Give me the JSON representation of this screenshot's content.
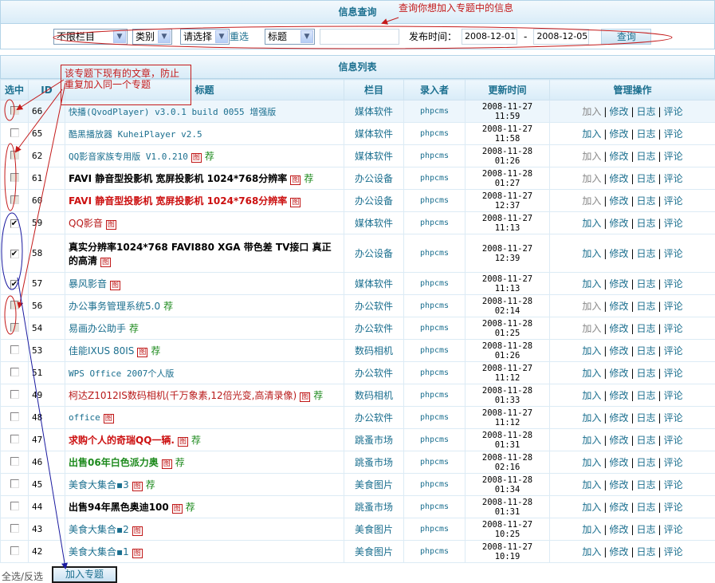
{
  "query_panel": {
    "title": "信息查询",
    "annotation": "查询你想加入专题中的信息",
    "column_select": "不限栏目",
    "type_select": "类别",
    "choose_select": "请选择",
    "reset_label": "重选",
    "field_select": "标题",
    "keyword_value": "",
    "date_label": "发布时间：",
    "date_from": "2008-12-01",
    "date_sep": "-",
    "date_to": "2008-12-05",
    "query_button": "查询"
  },
  "list_panel": {
    "title": "信息列表",
    "annotation": "该专题下现有的文章，防止重复加入同一个专题",
    "headers": [
      "选中",
      "ID",
      "标题",
      "栏目",
      "录入者",
      "更新时间",
      "管理操作"
    ],
    "ops": {
      "add": "加入",
      "edit": "修改",
      "log": "日志",
      "comment": "评论",
      "sep": "|"
    },
    "badge_img": "图",
    "badge_rec": "荐",
    "rows": [
      {
        "id": "66",
        "title": "快播(QvodPlayer) v3.0.1 build 0055 增强版",
        "style": "mono",
        "img": false,
        "rec": false,
        "category": "媒体软件",
        "user": "phpcms",
        "time": "2008-11-27 11:59",
        "check": "disabled",
        "add_disabled": true
      },
      {
        "id": "65",
        "title": "酷黑播放器 KuheiPlayer v2.5",
        "style": "mono",
        "img": false,
        "rec": false,
        "category": "媒体软件",
        "user": "phpcms",
        "time": "2008-11-27 11:58",
        "check": "unchecked",
        "add_disabled": false
      },
      {
        "id": "62",
        "title": "QQ影音家族专用版 V1.0.210",
        "style": "mono",
        "img": true,
        "rec": true,
        "category": "媒体软件",
        "user": "phpcms",
        "time": "2008-11-28 01:26",
        "check": "disabled",
        "add_disabled": true
      },
      {
        "id": "61",
        "title": "FAVI 静音型投影机 宽屏投影机 1024*768分辨率",
        "style": "bold",
        "img": true,
        "rec": true,
        "category": "办公设备",
        "user": "phpcms",
        "time": "2008-11-28 01:27",
        "check": "disabled",
        "add_disabled": true
      },
      {
        "id": "60",
        "title": "FAVI 静音型投影机 宽屏投影机 1024*768分辨率",
        "style": "red-bold",
        "img": true,
        "rec": false,
        "category": "办公设备",
        "user": "phpcms",
        "time": "2008-11-27 12:37",
        "check": "disabled",
        "add_disabled": true
      },
      {
        "id": "59",
        "title": "QQ影音",
        "style": "red",
        "img": true,
        "rec": false,
        "category": "媒体软件",
        "user": "phpcms",
        "time": "2008-11-27 11:13",
        "check": "checked",
        "add_disabled": false
      },
      {
        "id": "58",
        "title": "真实分辨率1024*768 FAVI880 XGA 带色差 TV接口 真正的高清",
        "style": "bold",
        "img": true,
        "rec": false,
        "category": "办公设备",
        "user": "phpcms",
        "time": "2008-11-27 12:39",
        "check": "checked",
        "add_disabled": false,
        "tall": true
      },
      {
        "id": "57",
        "title": "暴风影音",
        "style": "normal",
        "img": true,
        "rec": false,
        "category": "媒体软件",
        "user": "phpcms",
        "time": "2008-11-27 11:13",
        "check": "checked",
        "add_disabled": false
      },
      {
        "id": "56",
        "title": "办公事务管理系统5.0",
        "style": "normal",
        "img": false,
        "rec": true,
        "category": "办公软件",
        "user": "phpcms",
        "time": "2008-11-28 02:14",
        "check": "disabled",
        "add_disabled": true
      },
      {
        "id": "54",
        "title": "易画办公助手",
        "style": "normal",
        "img": false,
        "rec": true,
        "category": "办公软件",
        "user": "phpcms",
        "time": "2008-11-28 01:25",
        "check": "disabled",
        "add_disabled": true
      },
      {
        "id": "53",
        "title": "佳能IXUS 80IS",
        "style": "normal",
        "img": true,
        "rec": true,
        "category": "数码相机",
        "user": "phpcms",
        "time": "2008-11-28 01:26",
        "check": "unchecked",
        "add_disabled": false
      },
      {
        "id": "51",
        "title": "WPS Office 2007个人版",
        "style": "mono",
        "img": false,
        "rec": false,
        "category": "办公软件",
        "user": "phpcms",
        "time": "2008-11-27 11:12",
        "check": "unchecked",
        "add_disabled": false
      },
      {
        "id": "49",
        "title": "柯达Z1012IS数码相机(千万象素,12倍光变,高清录像)",
        "style": "red",
        "img": true,
        "rec": true,
        "category": "数码相机",
        "user": "phpcms",
        "time": "2008-11-28 01:33",
        "check": "unchecked",
        "add_disabled": false
      },
      {
        "id": "48",
        "title": "office",
        "style": "mono",
        "img": true,
        "rec": false,
        "category": "办公软件",
        "user": "phpcms",
        "time": "2008-11-27 11:12",
        "check": "unchecked",
        "add_disabled": false
      },
      {
        "id": "47",
        "title": "求购个人的奇瑞QQ一辆.",
        "style": "red-bold",
        "img": true,
        "rec": true,
        "category": "跳蚤市场",
        "user": "phpcms",
        "time": "2008-11-28 01:31",
        "check": "unchecked",
        "add_disabled": false
      },
      {
        "id": "46",
        "title": "出售06年白色派力奥",
        "style": "green-bold",
        "img": true,
        "rec": true,
        "category": "跳蚤市场",
        "user": "phpcms",
        "time": "2008-11-28 02:16",
        "check": "unchecked",
        "add_disabled": false
      },
      {
        "id": "45",
        "title": "美食大集合▪3",
        "style": "normal",
        "img": true,
        "rec": true,
        "category": "美食图片",
        "user": "phpcms",
        "time": "2008-11-28 01:34",
        "check": "unchecked",
        "add_disabled": false
      },
      {
        "id": "44",
        "title": "出售94年黑色奥迪100",
        "style": "bold",
        "img": true,
        "rec": true,
        "category": "跳蚤市场",
        "user": "phpcms",
        "time": "2008-11-28 01:31",
        "check": "unchecked",
        "add_disabled": false
      },
      {
        "id": "43",
        "title": "美食大集合▪2",
        "style": "normal",
        "img": true,
        "rec": false,
        "category": "美食图片",
        "user": "phpcms",
        "time": "2008-11-27 10:25",
        "check": "unchecked",
        "add_disabled": false
      },
      {
        "id": "42",
        "title": "美食大集合▪1",
        "style": "normal",
        "img": true,
        "rec": false,
        "category": "美食图片",
        "user": "phpcms",
        "time": "2008-11-27 10:19",
        "check": "unchecked",
        "add_disabled": false
      }
    ]
  },
  "footer": {
    "select_all": "全选/反选",
    "join_button": "加入专题"
  },
  "colors": {
    "accent": "#1b6f8f",
    "annotation_red": "#c41a1a",
    "annotation_blue": "#1a1aa0"
  }
}
